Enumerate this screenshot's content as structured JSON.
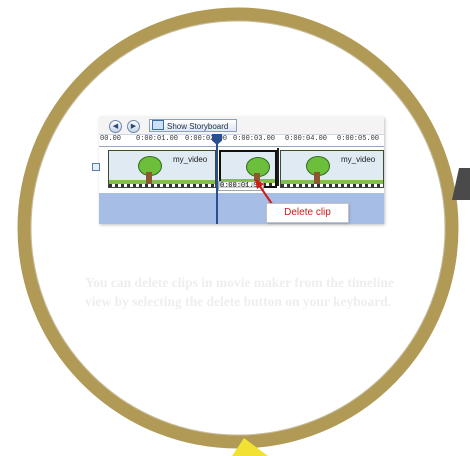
{
  "colors": {
    "ring": "#b09a55",
    "ring_dark": "#8f7b3e",
    "marker_dark": "#4a4a4a",
    "marker_yellow": "#f0e132",
    "callout_text": "#d11a1a",
    "timeline_lower": "#a6bde6"
  },
  "toolbar": {
    "back_icon": "rewind-icon",
    "play_icon": "play-icon",
    "storyboard_label": "Show Storyboard"
  },
  "ruler": {
    "ticks": [
      "00.00",
      "0:00:01.00",
      "0:00:02.00",
      "0:00:03.00",
      "0:00:04.00",
      "0:00:05.00"
    ]
  },
  "clips": [
    {
      "name": "my_video"
    },
    {
      "name": ""
    },
    {
      "name": "my_video"
    }
  ],
  "tooltip": {
    "time": "0:00:01.90"
  },
  "callout": {
    "label": "Delete clip"
  },
  "caption": {
    "text": "You can delete clips in movie maker from the timeline view by selecting the delete button on your keyboard."
  }
}
